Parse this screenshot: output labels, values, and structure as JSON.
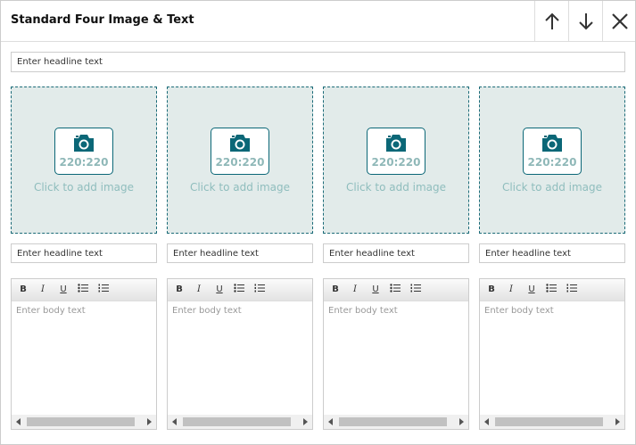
{
  "module": {
    "title": "Standard Four Image & Text",
    "move_up_icon": "arrow-up-icon",
    "move_down_icon": "arrow-down-icon",
    "remove_icon": "close-icon"
  },
  "headline": {
    "placeholder": "Enter headline text"
  },
  "blocks": [
    {
      "image": {
        "ratio": "220:220",
        "prompt": "Click to add image",
        "icon": "camera-icon"
      },
      "headline_placeholder": "Enter headline text",
      "body_placeholder": "Enter body text"
    },
    {
      "image": {
        "ratio": "220:220",
        "prompt": "Click to add image",
        "icon": "camera-icon"
      },
      "headline_placeholder": "Enter headline text",
      "body_placeholder": "Enter body text"
    },
    {
      "image": {
        "ratio": "220:220",
        "prompt": "Click to add image",
        "icon": "camera-icon"
      },
      "headline_placeholder": "Enter headline text",
      "body_placeholder": "Enter body text"
    },
    {
      "image": {
        "ratio": "220:220",
        "prompt": "Click to add image",
        "icon": "camera-icon"
      },
      "headline_placeholder": "Enter headline text",
      "body_placeholder": "Enter body text"
    }
  ],
  "toolbar": {
    "bold": "B",
    "italic": "I",
    "underline": "U",
    "bullet_list_icon": "bullet-list-icon",
    "numbered_list_icon": "numbered-list-icon"
  },
  "colors": {
    "image_bg": "#e2ebea",
    "image_border": "#1b6b78",
    "camera": "#0b6777",
    "prompt_text": "#8fbdbd"
  }
}
